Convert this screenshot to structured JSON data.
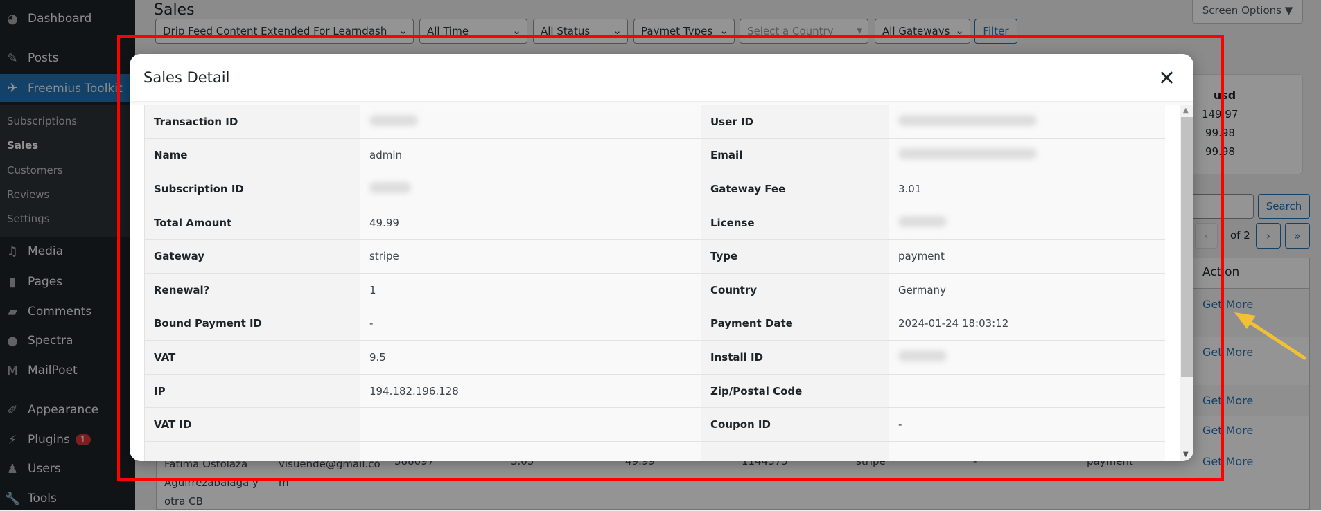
{
  "sidebar": {
    "items": [
      {
        "label": "Dashboard",
        "icon": "dashboard-icon"
      },
      {
        "label": "Posts",
        "icon": "pin-icon"
      },
      {
        "label": "Freemius Toolkit",
        "icon": "freemius-icon"
      },
      {
        "label": "Media",
        "icon": "media-icon"
      },
      {
        "label": "Pages",
        "icon": "pages-icon"
      },
      {
        "label": "Comments",
        "icon": "comment-icon"
      },
      {
        "label": "Spectra",
        "icon": "spectra-icon"
      },
      {
        "label": "MailPoet",
        "icon": "mailpoet-icon"
      },
      {
        "label": "Appearance",
        "icon": "brush-icon"
      },
      {
        "label": "Plugins",
        "icon": "plug-icon",
        "badge": "1"
      },
      {
        "label": "Users",
        "icon": "user-icon"
      },
      {
        "label": "Tools",
        "icon": "wrench-icon"
      }
    ],
    "submenu": [
      "Subscriptions",
      "Sales",
      "Customers",
      "Reviews",
      "Settings"
    ]
  },
  "page": {
    "title": "Sales",
    "screen_options": "Screen Options ▼",
    "filters": [
      "Drip Feed Content Extended For Learndash",
      "All Time",
      "All Status",
      "Paymet Types",
      "Select a Country",
      "All Gateways"
    ],
    "filter_button": "Filter",
    "stats": {
      "currency": "usd",
      "values": [
        "149.97",
        "99.98",
        "99.98"
      ]
    },
    "search_button": "Search",
    "pagination": {
      "prev": "‹",
      "of": "of 2",
      "next": "›",
      "last": "»"
    },
    "action_header": "Action",
    "get_more": "Get More",
    "bg_row": [
      "Fatima Ostolaza Aguirrezabalaga y otra CB",
      "visuende@gmail.com",
      "388097",
      "3.05",
      "49.99",
      "1144375",
      "stripe",
      "-",
      "payment"
    ]
  },
  "modal": {
    "title": "Sales Detail",
    "close": "✕",
    "rows": [
      {
        "l1": "Transaction ID",
        "v1": "",
        "l2": "User ID",
        "v2": ""
      },
      {
        "l1": "Name",
        "v1": "admin",
        "l2": "Email",
        "v2": ""
      },
      {
        "l1": "Subscription ID",
        "v1": "",
        "l2": "Gateway Fee",
        "v2": "3.01"
      },
      {
        "l1": "Total Amount",
        "v1": "49.99",
        "l2": "License",
        "v2": ""
      },
      {
        "l1": "Gateway",
        "v1": "stripe",
        "l2": "Type",
        "v2": "payment"
      },
      {
        "l1": "Renewal?",
        "v1": "1",
        "l2": "Country",
        "v2": "Germany"
      },
      {
        "l1": "Bound Payment ID",
        "v1": "-",
        "l2": "Payment Date",
        "v2": "2024-01-24 18:03:12"
      },
      {
        "l1": "VAT",
        "v1": "9.5",
        "l2": "Install ID",
        "v2": ""
      },
      {
        "l1": "IP",
        "v1": "194.182.196.128",
        "l2": "Zip/Postal Code",
        "v2": ""
      },
      {
        "l1": "VAT ID",
        "v1": "",
        "l2": "Coupon ID",
        "v2": "-"
      },
      {
        "l1": "",
        "v1": "",
        "l2": "",
        "v2": ""
      }
    ]
  },
  "colors": {
    "highlight": "#ff0000",
    "arrow": "#f2c037",
    "accent": "#2271b1"
  }
}
